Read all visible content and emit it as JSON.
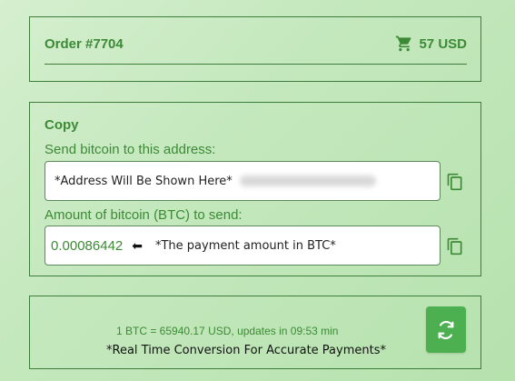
{
  "order": {
    "title": "Order #7704",
    "total": "57 USD",
    "cart_icon": "cart-icon"
  },
  "copy_section": {
    "title": "Copy",
    "address_label": "Send bitcoin to this address:",
    "address_value": "*Address Will Be Shown Here*",
    "amount_label": "Amount of bitcoin (BTC) to send:",
    "amount_value": "0.00086442",
    "amount_arrow": "⬅",
    "amount_hint": "*The payment amount in BTC*",
    "copy_icon": "copy-icon"
  },
  "rate": {
    "text": "1 BTC = 65940.17 USD, updates in 09:53 min",
    "note": "*Real Time Conversion For Accurate Payments*",
    "refresh_icon": "refresh-icon"
  },
  "colors": {
    "accent_green": "#3c8a36",
    "button_green": "#4caf50",
    "border": "#3f7d3c"
  }
}
